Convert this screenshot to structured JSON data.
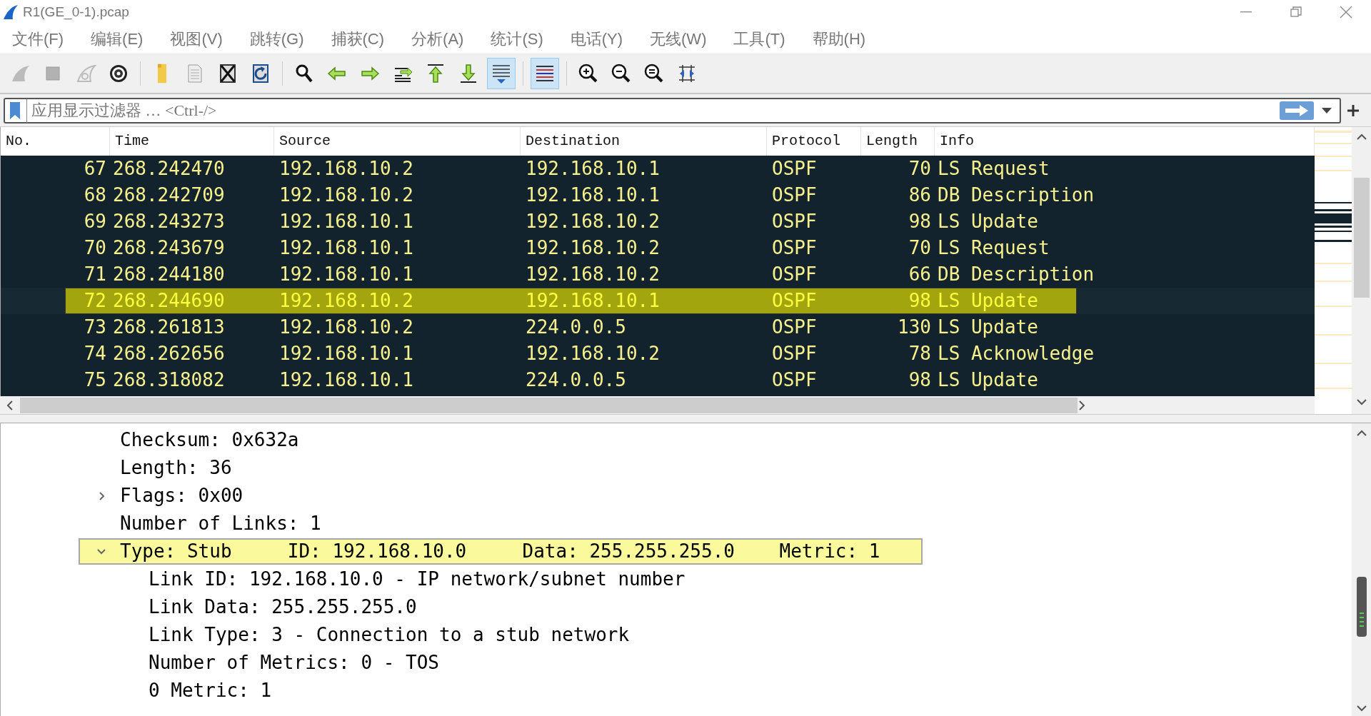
{
  "window": {
    "title": "R1(GE_0-1).pcap"
  },
  "menu": [
    "文件(F)",
    "编辑(E)",
    "视图(V)",
    "跳转(G)",
    "捕获(C)",
    "分析(A)",
    "统计(S)",
    "电话(Y)",
    "无线(W)",
    "工具(T)",
    "帮助(H)"
  ],
  "toolbar": [
    {
      "disabled": true,
      "on": false
    },
    {
      "disabled": true,
      "on": false
    },
    {
      "disabled": true,
      "on": false
    },
    {
      "disabled": false,
      "on": false
    },
    {
      "disabled": false,
      "on": false
    },
    {
      "disabled": false,
      "on": false
    },
    {
      "disabled": false,
      "on": false
    },
    {
      "disabled": false,
      "on": false
    },
    {
      "disabled": false,
      "on": false
    },
    {
      "disabled": false,
      "on": false
    },
    {
      "disabled": false,
      "on": false
    },
    {
      "disabled": false,
      "on": false
    },
    {
      "disabled": false,
      "on": false
    },
    {
      "disabled": false,
      "on": false
    },
    {
      "disabled": false,
      "on": true
    },
    {
      "disabled": false,
      "on": true
    },
    {
      "disabled": false,
      "on": false
    },
    {
      "disabled": false,
      "on": false
    },
    {
      "disabled": false,
      "on": false
    },
    {
      "disabled": false,
      "on": false
    }
  ],
  "filter": {
    "placeholder": "应用显示过滤器 … <Ctrl-/>"
  },
  "packet_list": {
    "columns": [
      "No.",
      "Time",
      "Source",
      "Destination",
      "Protocol",
      "Length",
      "Info"
    ],
    "rows": [
      {
        "no": "67",
        "time": "268.242470",
        "source": "192.168.10.2",
        "destination": "192.168.10.1",
        "protocol": "OSPF",
        "length": "70",
        "info": "LS Request",
        "selected": false
      },
      {
        "no": "68",
        "time": "268.242709",
        "source": "192.168.10.2",
        "destination": "192.168.10.1",
        "protocol": "OSPF",
        "length": "86",
        "info": "DB Description",
        "selected": false
      },
      {
        "no": "69",
        "time": "268.243273",
        "source": "192.168.10.1",
        "destination": "192.168.10.2",
        "protocol": "OSPF",
        "length": "98",
        "info": "LS Update",
        "selected": false
      },
      {
        "no": "70",
        "time": "268.243679",
        "source": "192.168.10.1",
        "destination": "192.168.10.2",
        "protocol": "OSPF",
        "length": "70",
        "info": "LS Request",
        "selected": false
      },
      {
        "no": "71",
        "time": "268.244180",
        "source": "192.168.10.1",
        "destination": "192.168.10.2",
        "protocol": "OSPF",
        "length": "66",
        "info": "DB Description",
        "selected": false
      },
      {
        "no": "72",
        "time": "268.244690",
        "source": "192.168.10.2",
        "destination": "192.168.10.1",
        "protocol": "OSPF",
        "length": "98",
        "info": "LS Update",
        "selected": true
      },
      {
        "no": "73",
        "time": "268.261813",
        "source": "192.168.10.2",
        "destination": "224.0.0.5",
        "protocol": "OSPF",
        "length": "130",
        "info": "LS Update",
        "selected": false
      },
      {
        "no": "74",
        "time": "268.262656",
        "source": "192.168.10.1",
        "destination": "192.168.10.2",
        "protocol": "OSPF",
        "length": "78",
        "info": "LS Acknowledge",
        "selected": false
      },
      {
        "no": "75",
        "time": "268.318082",
        "source": "192.168.10.1",
        "destination": "224.0.0.5",
        "protocol": "OSPF",
        "length": "98",
        "info": "LS Update",
        "selected": false
      }
    ]
  },
  "details": [
    {
      "text": "Checksum: 0x632a",
      "selected": false
    },
    {
      "text": "Length: 36",
      "selected": false
    },
    {
      "text": "Flags: 0x00",
      "selected": false,
      "expanded": false
    },
    {
      "text": "Number of Links: 1",
      "selected": false
    },
    {
      "text": "Type: Stub     ID: 192.168.10.0     Data: 255.255.255.0    Metric: 1",
      "selected": true,
      "expanded": true,
      "children": [
        {
          "text": "Link ID: 192.168.10.0 - IP network/subnet number",
          "selected": false
        },
        {
          "text": "Link Data: 255.255.255.0",
          "selected": false
        },
        {
          "text": "Link Type: 3 - Connection to a stub network",
          "selected": false
        },
        {
          "text": "Number of Metrics: 0 - TOS",
          "selected": false
        },
        {
          "text": "0 Metric: 1",
          "selected": false
        }
      ]
    }
  ]
}
